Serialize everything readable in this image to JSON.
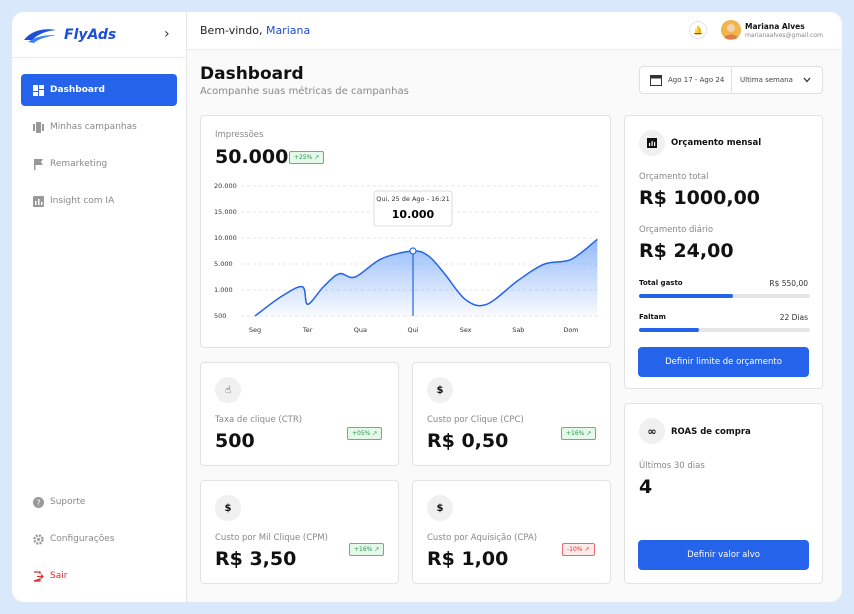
{
  "brand": {
    "name": "FlyAds"
  },
  "sidebar": {
    "items": [
      {
        "label": "Dashboard"
      },
      {
        "label": "Minhas campanhas"
      },
      {
        "label": "Remarketing"
      },
      {
        "label": "Insight com IA"
      }
    ],
    "bottom": [
      {
        "label": "Suporte"
      },
      {
        "label": "Configurações"
      },
      {
        "label": "Sair"
      }
    ]
  },
  "topbar": {
    "welcome": "Bem-vindo,",
    "user_first": "Mariana",
    "user_name": "Mariana Alves",
    "user_email": "marianaalves@gmail.com"
  },
  "header": {
    "title": "Dashboard",
    "subtitle": "Acompanhe suas métricas de campanhas"
  },
  "date_filter": {
    "range": "Ago 17 - Ago 24",
    "period": "Ultima semana"
  },
  "impressions": {
    "label": "Impressões",
    "value": "50.000",
    "badge": "+25%"
  },
  "chart_data": {
    "type": "area",
    "categories": [
      "Seg",
      "Ter",
      "Qua",
      "Qui",
      "Sex",
      "Sab",
      "Dom"
    ],
    "ylim": [
      0,
      20000
    ],
    "yticks": [
      "20.000",
      "15.000",
      "10.000",
      "5.000",
      "1.000",
      "500"
    ],
    "x": [
      0,
      0.5,
      0.9,
      1.0,
      1.3,
      1.6,
      1.9,
      2.4,
      3.0,
      3.3,
      3.6,
      4.0,
      4.4,
      5.0,
      5.5,
      6.0,
      6.5
    ],
    "values": [
      0,
      3000,
      4500,
      1800,
      4500,
      6500,
      6000,
      8800,
      10000,
      9200,
      6500,
      2500,
      1800,
      5500,
      8000,
      8700,
      11800
    ],
    "tooltip": {
      "date": "Qui, 25 de Ago - 16:21",
      "value": "10.000",
      "x": 3.0
    }
  },
  "metrics": [
    {
      "label": "Taxa de clique (CTR)",
      "value": "500",
      "badge": "+05%",
      "trend": "up",
      "icon": "pointer-hand-icon"
    },
    {
      "label": "Custo por Clique (CPC)",
      "value": "R$ 0,50",
      "badge": "+16%",
      "trend": "up",
      "icon": "dollar-icon"
    },
    {
      "label": "Custo por Mil  Clique (CPM)",
      "value": "R$ 3,50",
      "badge": "+16%",
      "trend": "up",
      "icon": "dollar-icon"
    },
    {
      "label": "Custo por Aquisição (CPA)",
      "value": "R$ 1,00",
      "badge": "-10%",
      "trend": "down",
      "icon": "dollar-icon"
    }
  ],
  "budget": {
    "title": "Orçamento  mensal",
    "total_label": "Orçamento total",
    "total_value": "R$ 1000,00",
    "daily_label": "Orçamento diário",
    "daily_value": "R$ 24,00",
    "spent_label": "Total gasto",
    "spent_value": "R$  550,00",
    "spent_fraction": 0.55,
    "remaining_label": "Faltam",
    "remaining_value": "22 Dias",
    "remaining_fraction": 0.35,
    "button": "Definir limite de orçamento"
  },
  "roas": {
    "title": "ROAS de compra",
    "label": "Últimos 30 dias",
    "value": "4",
    "button": "Definir valor alvo"
  },
  "colors": {
    "accent": "#2563eb",
    "positive": "#1f9d48",
    "negative": "#d33333"
  }
}
